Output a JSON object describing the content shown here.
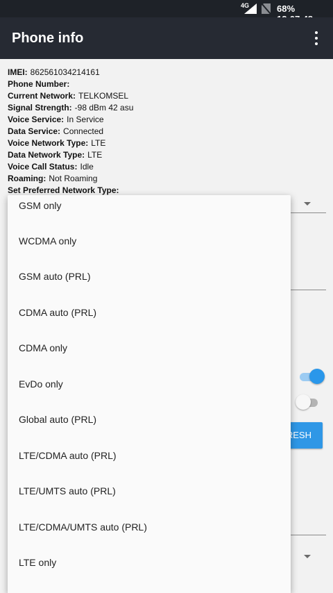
{
  "status_bar": {
    "network_type": "4G",
    "battery": "68%",
    "time": "12:07:48"
  },
  "app_bar": {
    "title": "Phone info"
  },
  "phone_info": [
    {
      "label": "IMEI:",
      "value": "862561034214161"
    },
    {
      "label": "Phone Number:",
      "value": ""
    },
    {
      "label": "Current Network:",
      "value": "TELKOMSEL"
    },
    {
      "label": "Signal Strength:",
      "value": "-98 dBm   42 asu"
    },
    {
      "label": "Voice Service:",
      "value": "In Service"
    },
    {
      "label": "Data Service:",
      "value": "Connected"
    },
    {
      "label": "Voice Network Type:",
      "value": "LTE"
    },
    {
      "label": "Data Network Type:",
      "value": "LTE"
    },
    {
      "label": "Voice Call Status:",
      "value": "Idle"
    },
    {
      "label": "Roaming:",
      "value": "Not Roaming"
    },
    {
      "label": "Set Preferred Network Type:",
      "value": ""
    }
  ],
  "background": {
    "refresh_button_partial": "RESH",
    "toggle_1_on": true,
    "toggle_2_on": false,
    "accent_color": "#2a97ea"
  },
  "network_type_dropdown": {
    "options": [
      "GSM only",
      "WCDMA only",
      "GSM auto (PRL)",
      "CDMA auto (PRL)",
      "CDMA only",
      "EvDo only",
      "Global auto (PRL)",
      "LTE/CDMA auto (PRL)",
      "LTE/UMTS auto (PRL)",
      "LTE/CDMA/UMTS auto (PRL)",
      "LTE only"
    ]
  }
}
